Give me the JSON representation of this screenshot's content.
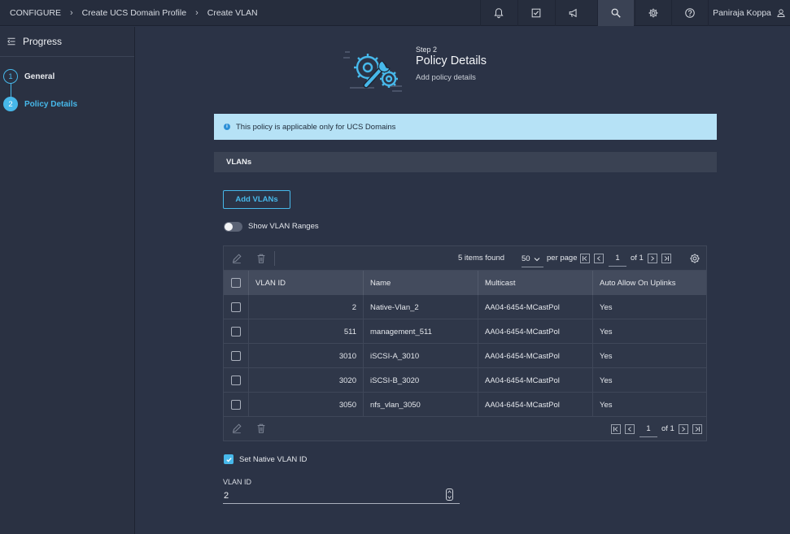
{
  "breadcrumb": {
    "items": [
      "CONFIGURE",
      "Create UCS Domain Profile",
      "Create VLAN"
    ]
  },
  "header": {
    "user_name": "Paniraja Koppa"
  },
  "progress": {
    "title": "Progress",
    "steps": [
      {
        "number": "1",
        "label": "General"
      },
      {
        "number": "2",
        "label": "Policy Details"
      }
    ]
  },
  "page": {
    "step_label": "Step 2",
    "title": "Policy Details",
    "subtitle": "Add policy details"
  },
  "info_banner": {
    "text": "This policy is applicable only for UCS Domains"
  },
  "section": {
    "title": "VLANs"
  },
  "add_button": {
    "label": "Add VLANs"
  },
  "ranges_toggle": {
    "label": "Show VLAN Ranges",
    "on": false
  },
  "table": {
    "items_found": "5 items found",
    "per_page_value": "50",
    "per_page_label": "per page",
    "page": "1",
    "of_pages": "of 1",
    "columns": [
      "VLAN ID",
      "Name",
      "Multicast",
      "Auto Allow On Uplinks"
    ],
    "rows": [
      {
        "vlan_id": "2",
        "name": "Native-Vlan_2",
        "multicast": "AA04-6454-MCastPol",
        "auto_allow": "Yes"
      },
      {
        "vlan_id": "511",
        "name": "management_511",
        "multicast": "AA04-6454-MCastPol",
        "auto_allow": "Yes"
      },
      {
        "vlan_id": "3010",
        "name": "iSCSI-A_3010",
        "multicast": "AA04-6454-MCastPol",
        "auto_allow": "Yes"
      },
      {
        "vlan_id": "3020",
        "name": "iSCSI-B_3020",
        "multicast": "AA04-6454-MCastPol",
        "auto_allow": "Yes"
      },
      {
        "vlan_id": "3050",
        "name": "nfs_vlan_3050",
        "multicast": "AA04-6454-MCastPol",
        "auto_allow": "Yes"
      }
    ]
  },
  "native_vlan": {
    "label": "Set Native VLAN ID",
    "checked": true
  },
  "vlan_id_field": {
    "label": "VLAN ID",
    "value": "2"
  },
  "colors": {
    "accent": "#47b8ea",
    "banner": "#b6e2f6",
    "background": "#2b3346"
  }
}
